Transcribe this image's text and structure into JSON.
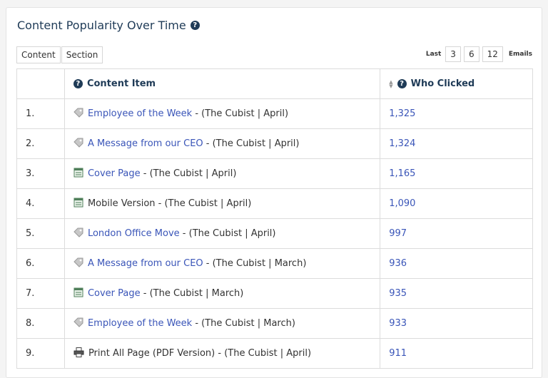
{
  "title": "Content Popularity Over Time",
  "help_glyph": "?",
  "segments": [
    "Content",
    "Section"
  ],
  "filter": {
    "last_label": "Last",
    "options": [
      "3",
      "6",
      "12"
    ],
    "emails_label": "Emails"
  },
  "table": {
    "headers": {
      "item": "Content Item",
      "clicks": "Who Clicked"
    },
    "rows": [
      {
        "rank": "1.",
        "icon": "tag-icon",
        "link": "Employee of the Week",
        "text": " - (The Cubist | April)",
        "clicks": "1,325"
      },
      {
        "rank": "2.",
        "icon": "tag-icon",
        "link": "A Message from our CEO",
        "text": " - (The Cubist | April)",
        "clicks": "1,324"
      },
      {
        "rank": "3.",
        "icon": "page-icon",
        "link": "Cover Page",
        "text": " - (The Cubist | April)",
        "clicks": "1,165"
      },
      {
        "rank": "4.",
        "icon": "page-icon",
        "link": "",
        "text": "Mobile Version - (The Cubist | April)",
        "clicks": "1,090"
      },
      {
        "rank": "5.",
        "icon": "tag-icon",
        "link": "London Office Move",
        "text": " - (The Cubist | April)",
        "clicks": "997"
      },
      {
        "rank": "6.",
        "icon": "tag-icon",
        "link": "A Message from our CEO",
        "text": " - (The Cubist | March)",
        "clicks": "936"
      },
      {
        "rank": "7.",
        "icon": "page-icon",
        "link": "Cover Page",
        "text": " - (The Cubist | March)",
        "clicks": "935"
      },
      {
        "rank": "8.",
        "icon": "tag-icon",
        "link": "Employee of the Week",
        "text": " - (The Cubist | March)",
        "clicks": "933"
      },
      {
        "rank": "9.",
        "icon": "printer-icon",
        "link": "",
        "text": "Print All Page (PDF Version) - (The Cubist | April)",
        "clicks": "911"
      }
    ]
  }
}
